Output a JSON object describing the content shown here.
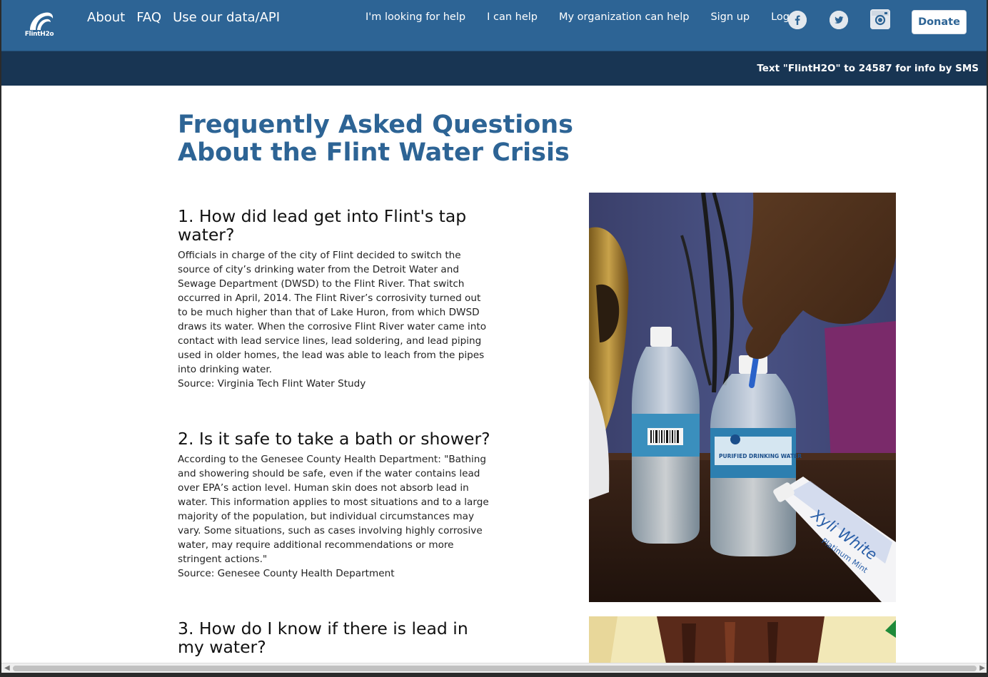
{
  "logo": {
    "text": "FlintH2o"
  },
  "nav": {
    "main": [
      "About",
      "FAQ",
      "Use our data/API"
    ],
    "right": [
      "I'm looking for help",
      "I can help",
      "My organization can help",
      "Sign up",
      "Log in"
    ],
    "donate_label": "Donate"
  },
  "social": [
    "facebook-icon",
    "twitter-icon",
    "instagram-icon"
  ],
  "sms_banner": "Text \"FlintH2O\" to 24587 for info by SMS",
  "page_title": "Frequently Asked Questions About the Flint Water Crisis",
  "faq": [
    {
      "question": "1. How did lead get into Flint's tap water?",
      "answer": "Officials in charge of the city of Flint decided to switch the source of city’s drinking water from the Detroit Water and Sewage Department (DWSD) to the Flint River. That switch occurred in April, 2014. The Flint River’s corrosivity turned out to be much higher than that of Lake Huron, from which DWSD draws its water. When the corrosive Flint River water came into contact with lead service lines, lead soldering, and lead piping used in older homes, the lead was able to leach from the pipes into drinking water.",
      "source": "Source: Virginia Tech Flint Water Study"
    },
    {
      "question": "2. Is it safe to take a bath or shower?",
      "answer": "According to the Genesee County Health Department: \"Bathing and showering should be safe, even if the water contains lead over EPA’s action level. Human skin does not absorb lead in water. This information applies to most situations and to a large majority of the population, but individual circumstances may vary. Some situations, such as cases involving highly corrosive water, may require additional recommendations or more stringent actions.\"",
      "source": "Source: Genesee County Health Department"
    },
    {
      "question": "3. How do I know if there is lead in my water?"
    }
  ],
  "photo1_labels": {
    "bottle_label": "PURIFIED DRINKING WATER",
    "toothpaste": "Xyli White",
    "toothpaste_sub": "Platinum Mint"
  },
  "colors": {
    "header_blue": "#2d6495",
    "sms_bar": "#183553",
    "title_blue": "#2d6495"
  }
}
